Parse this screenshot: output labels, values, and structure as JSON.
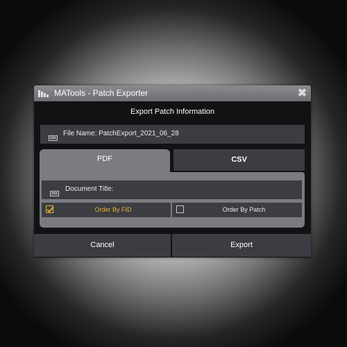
{
  "window": {
    "title": "MATools - Patch Exporter",
    "icons": {
      "app": "app-logo-icon",
      "close": "close-icon",
      "close_glyph": "✖"
    }
  },
  "dialog": {
    "heading": "Export Patch Information",
    "file_name_field": {
      "label": "File Name: PatchExport_2021_06_28",
      "icon": "keyboard-icon"
    },
    "tabs": [
      {
        "label": "PDF",
        "active": true
      },
      {
        "label": "CSV",
        "active": false
      }
    ],
    "document_title_field": {
      "label": "Document Title:",
      "icon": "keyboard-icon"
    },
    "sort_options": [
      {
        "label": "Order By FID",
        "checked": true
      },
      {
        "label": "Order By Patch",
        "checked": false
      }
    ],
    "buttons": {
      "cancel": "Cancel",
      "export": "Export"
    }
  },
  "colors": {
    "accent": "#e6b22e",
    "panel": "#7b7c82",
    "field": "#3c3d42",
    "window_bg": "#111214",
    "titlebar": "#7d7e82"
  }
}
